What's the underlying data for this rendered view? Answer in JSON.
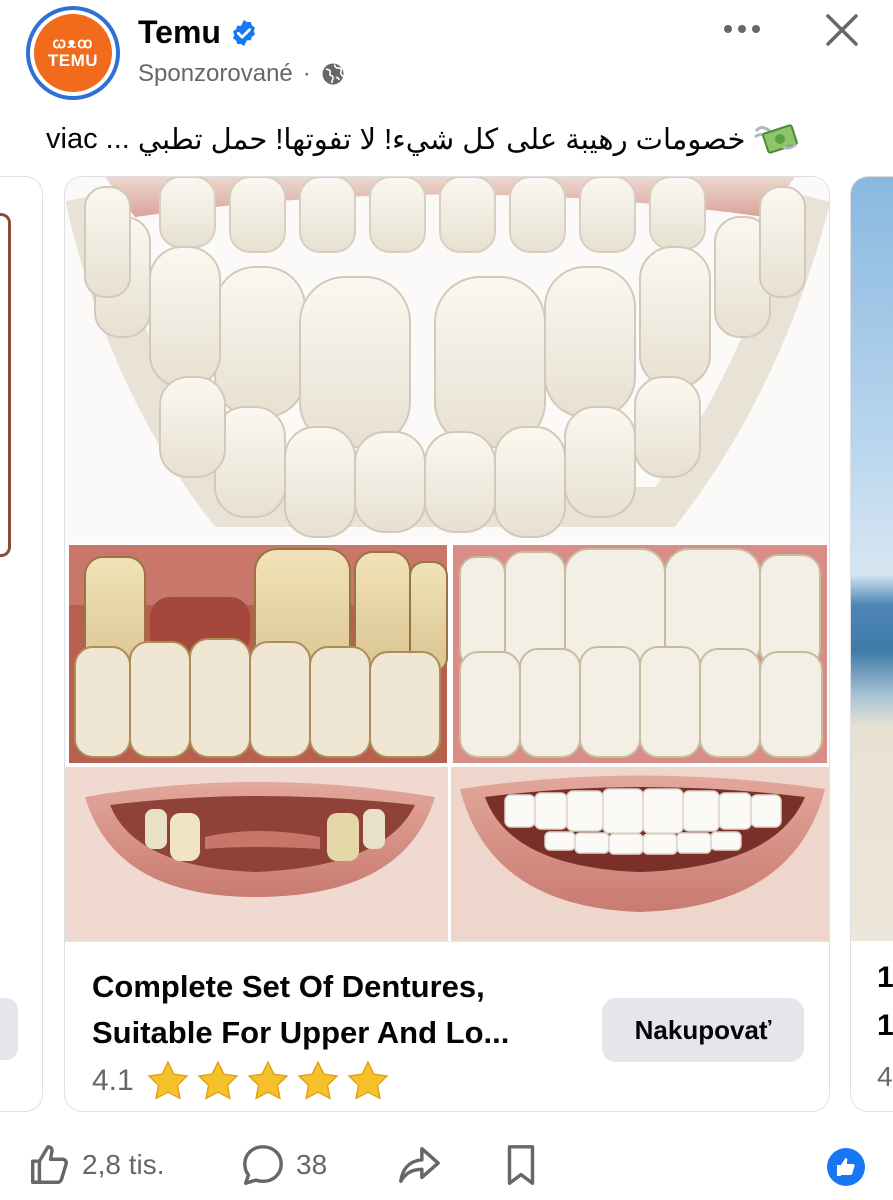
{
  "post": {
    "page_name": "Temu",
    "sponsored_label": "Sponzorované",
    "separator": "·",
    "avatar_glyphs": "ꞷᴥꝏ",
    "avatar_text": "TEMU",
    "caption_text": "خصومات رهيبة على كل شيء! لا تفوتها! حمل تطبي",
    "caption_more": "viac",
    "caption_ellipsis": "..."
  },
  "card": {
    "product_title": "Complete Set Of Dentures, Suitable For Upper And Lo...",
    "rating_value": "4.1",
    "rating_stars": 5,
    "shop_button_label": "Nakupovať"
  },
  "next_card": {
    "title_line1": "1",
    "title_line2": "1",
    "rating": "4"
  },
  "actions": {
    "likes_count": "2,8 tis.",
    "comments_count": "38"
  },
  "colors": {
    "brand_orange": "#f26a1b",
    "verified_blue": "#1877f2",
    "secondary_text": "#65676b",
    "button_gray": "#e4e6eb",
    "star_gold": "#f7c12c"
  },
  "icons": [
    "verified-badge-icon",
    "globe-icon",
    "more-options-icon",
    "close-icon",
    "money-with-wings-icon",
    "star-icon",
    "like-icon",
    "comment-icon",
    "share-icon",
    "bookmark-icon",
    "like-reaction-icon"
  ]
}
